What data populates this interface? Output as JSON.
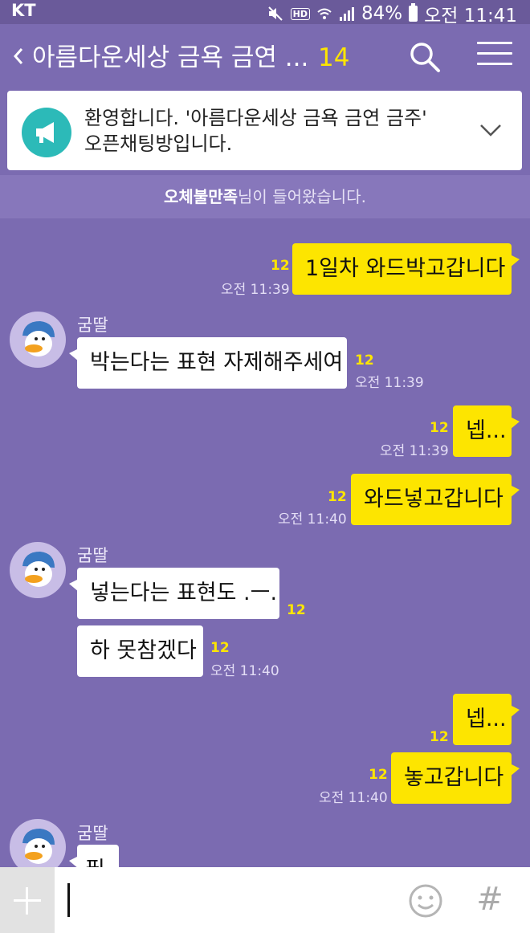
{
  "status_bar": {
    "carrier": "KT",
    "battery": "84%",
    "time": "오전 11:41",
    "hd_label": "HD",
    "icons": [
      "mute-icon",
      "hd-icon",
      "wifi-icon",
      "signal-icon",
      "battery-icon"
    ]
  },
  "header": {
    "back_icon": "back-arrow-icon",
    "title": "아름다운세상 금욕 금연 ...",
    "member_count": "14",
    "search_icon": "search-icon",
    "menu_icon": "menu-icon"
  },
  "notice": {
    "icon": "megaphone-icon",
    "line1": "환영합니다. '아름다운세상 금욕 금연 금주'",
    "line2": "오픈채팅방입니다.",
    "expand_icon": "chevron-down-icon"
  },
  "system_message": {
    "name": "오체불만족",
    "text": "님이 들어왔습니다."
  },
  "messages": [
    {
      "side": "me",
      "text": "1일차 와드박고갑니다",
      "unread": "12",
      "time": "오전 11:39"
    },
    {
      "side": "them",
      "sender": "굼딸",
      "text": "박는다는 표현 자제해주세여",
      "unread": "12",
      "time": "오전 11:39"
    },
    {
      "side": "me",
      "text": "넵...",
      "unread": "12",
      "time": "오전 11:39"
    },
    {
      "side": "me",
      "text": "와드넣고갑니다",
      "unread": "12",
      "time": "오전 11:40"
    },
    {
      "side": "them",
      "sender": "굼딸",
      "text": "넣는다는 표현도 .ㅡ.",
      "unread": "12",
      "time": ""
    },
    {
      "side": "them",
      "sender": "",
      "text": "하 못참겠다",
      "unread": "12",
      "time": "오전 11:40"
    },
    {
      "side": "me",
      "text": "넵...",
      "unread": "12",
      "time": ""
    },
    {
      "side": "me",
      "text": "놓고갑니다",
      "unread": "12",
      "time": "오전 11:40"
    },
    {
      "side": "them",
      "sender": "굼딸",
      "text": "필",
      "unread": "",
      "time": ""
    }
  ],
  "input_bar": {
    "plus_icon": "plus-icon",
    "value": "",
    "emoji_icon": "emoticon-icon",
    "hash_label": "#"
  },
  "colors": {
    "background": "#7b6bb1",
    "my_bubble": "#fde500",
    "their_bubble": "#ffffff",
    "unread": "#fde500",
    "notice_icon": "#2cbab8"
  }
}
